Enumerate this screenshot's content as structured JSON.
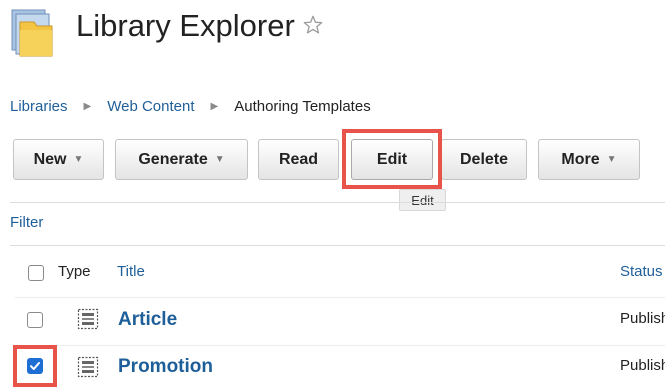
{
  "header": {
    "title": "Library Explorer"
  },
  "breadcrumb": {
    "items": [
      "Libraries",
      "Web Content",
      "Authoring Templates"
    ],
    "separator": "▶"
  },
  "toolbar": {
    "new_label": "New",
    "generate_label": "Generate",
    "read_label": "Read",
    "edit_label": "Edit",
    "delete_label": "Delete",
    "more_label": "More",
    "caret": "▼",
    "tooltip": "Edit"
  },
  "filter_label": "Filter",
  "table": {
    "columns": [
      "Type",
      "Title",
      "Status"
    ],
    "rows": [
      {
        "title": "Article",
        "status": "Published",
        "checked": false
      },
      {
        "title": "Promotion",
        "status": "Published",
        "checked": true
      }
    ]
  },
  "colors": {
    "link": "#1f5f99",
    "highlight": "#e8534a",
    "checkbox_checked": "#1f6ed4"
  },
  "icons": [
    "library-folder-icon",
    "favorite-star-icon",
    "breadcrumb-arrow-icon",
    "dropdown-caret-icon",
    "template-icon"
  ]
}
